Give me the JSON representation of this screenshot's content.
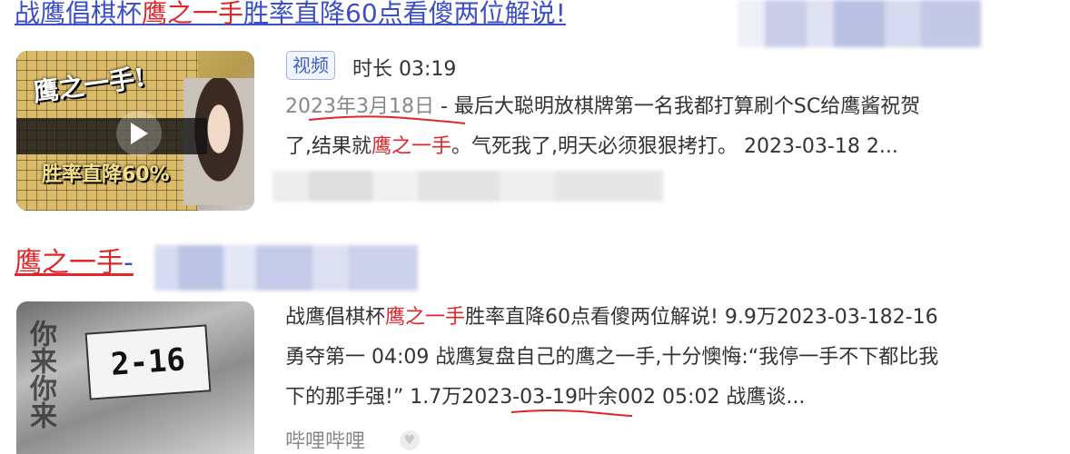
{
  "result1": {
    "title_before": "战鹰倡棋杯",
    "title_highlight": "鹰之一手",
    "title_after": "胜率直降60点看傻两位解说!",
    "thumbnail": {
      "top_text": "鹰之一手!",
      "bottom_text": "胜率直降60%",
      "play_icon": "play-icon"
    },
    "badge": "视频",
    "duration": "时长 03:19",
    "date": "2023年3月18日",
    "snippet_part1": " - 最后大聪明放棋牌第一名我都打算刷个SC给鹰酱祝贺",
    "snippet_part2_before": "了,结果就",
    "snippet_highlight": "鹰之一手",
    "snippet_part2_after": "。气死我了,明天必须狠狠拷打。 2023-03-18 2..."
  },
  "result2": {
    "title_highlight": "鹰之一手",
    "title_dash": "-",
    "thumbnail": {
      "sign_text": "2-16",
      "scribble_text": "你来你来"
    },
    "line1_before": "战鹰倡棋杯",
    "line1_highlight": "鹰之一手",
    "line1_after": "胜率直降60点看傻两位解说! 9.9万2023-03-182-16",
    "line2": "勇夺第一 04:09 战鹰复盘自己的鹰之一手,十分懊悔:“我停一手不下都比我",
    "line3": "下的那手强!” 1.7万2023-03-19叶余002 05:02 战鹰谈...",
    "source": "哔哩哔哩"
  },
  "colors": {
    "link": "#3b4fc9",
    "highlight": "#e0262a",
    "muted": "#888888",
    "text": "#333333"
  }
}
